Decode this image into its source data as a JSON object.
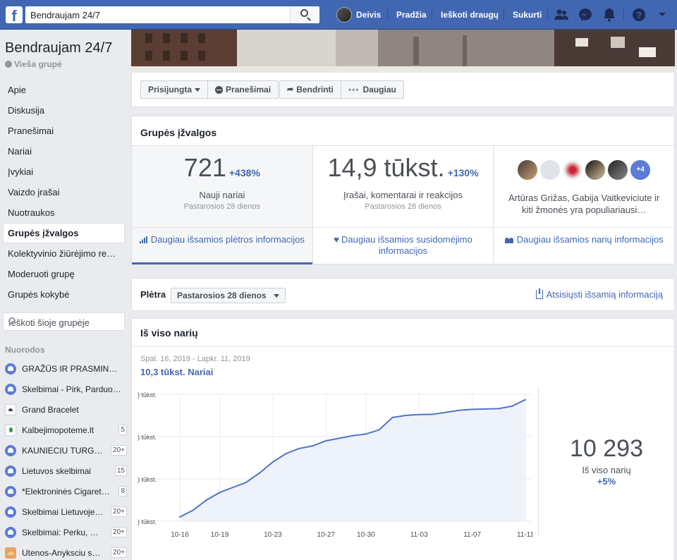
{
  "topbar": {
    "logo": "f",
    "search_value": "Bendraujam 24/7",
    "user_name": "Deivis",
    "nav": [
      "Pradžia",
      "Ieškoti draugų",
      "Sukurti"
    ],
    "icons": [
      "friends-icon",
      "messenger-icon",
      "notifications-icon",
      "help-icon",
      "dropdown-icon"
    ]
  },
  "sidebar": {
    "group_name": "Bendraujam 24/7",
    "group_type": "Vieša grupė",
    "menu": [
      "Apie",
      "Diskusija",
      "Pranešimai",
      "Nariai",
      "Įvykiai",
      "Vaizdo įrašai",
      "Nuotraukos",
      "Grupės įžvalgos",
      "Kolektyvinio žiūrėjimo re…",
      "Moderuoti grupę",
      "Grupės kokybė"
    ],
    "active_item": "Grupės įžvalgos",
    "search_placeholder": "Ieškoti šioje grupėje",
    "shortcuts_title": "Nuorodos",
    "shortcuts": [
      {
        "label": "GRAŽŪS IR PRASMIN…",
        "count": "",
        "icon": "group-icon"
      },
      {
        "label": "Skelbimai - Pirk, Parduo…",
        "count": "",
        "icon": "group-icon"
      },
      {
        "label": "Grand Bracelet",
        "count": "",
        "icon": "page-icon"
      },
      {
        "label": "Kalbejimopoteme.lt",
        "count": "5",
        "icon": "leaf-icon"
      },
      {
        "label": "KAUNIECIU TURG…",
        "count": "20+",
        "icon": "group-icon"
      },
      {
        "label": "Lietuvos skelbimai",
        "count": "15",
        "icon": "group-icon"
      },
      {
        "label": "*Elektroninės Cigaret…",
        "count": "8",
        "icon": "group-icon"
      },
      {
        "label": "Skelbimai Lietuvoje…",
        "count": "20+",
        "icon": "group-icon"
      },
      {
        "label": "Skelbimai: Perku, …",
        "count": "20+",
        "icon": "group-icon"
      },
      {
        "label": "Utenos-Anyksciu s…",
        "count": "20+",
        "icon": "hand-icon"
      }
    ]
  },
  "actions": {
    "joined": "Prisijungta",
    "notifications": "Pranešimai",
    "share": "Bendrinti",
    "more": "Daugiau"
  },
  "insights": {
    "title": "Grupės įžvalgos",
    "members": {
      "value": "721",
      "change": "+438%",
      "label": "Nauji nariai",
      "period": "Pastarosios 28 dienos",
      "link": "Daugiau išsamios plėtros informacijos"
    },
    "engagement": {
      "value": "14,9 tūkst.",
      "change": "+130%",
      "label": "Įrašai, komentarai ir reakcijos",
      "period": "Pastarosios 28 dienos",
      "link": "Daugiau išsamios susidomėjimo informacijos"
    },
    "people": {
      "more": "+4",
      "text": "Artūras Grižas, Gabija Vaitkeviciute ir kiti žmonės yra populiariausi…",
      "link": "Daugiau išsamios narių informacijos"
    }
  },
  "growth": {
    "title": "Plėtra",
    "period_select": "Pastarosios 28 dienos",
    "download": "Atsisiųsti išsamią informaciją"
  },
  "totals": {
    "title": "Iš viso narių",
    "date_range": "Spal. 16, 2019 - Lapkr. 11, 2019",
    "series_label": "10,3 tūkst.  Nariai",
    "total_value": "10 293",
    "total_label": "Iš viso narių",
    "total_change": "+5%"
  },
  "chart_data": {
    "type": "area",
    "x": [
      "10-16",
      "10-17",
      "10-18",
      "10-19",
      "10-20",
      "10-21",
      "10-22",
      "10-23",
      "10-24",
      "10-25",
      "10-26",
      "10-27",
      "10-28",
      "10-29",
      "10-30",
      "10-31",
      "11-01",
      "11-02",
      "11-03",
      "11-04",
      "11-05",
      "11-06",
      "11-07",
      "11-08",
      "11-09",
      "11-10",
      "11-11"
    ],
    "xticks": [
      "10-16",
      "10-19",
      "10-23",
      "10-27",
      "10-30",
      "11-03",
      "11-07",
      "11-11"
    ],
    "ytick_labels": [
      ") tūkst.",
      ") tūkst.",
      ") tūkst.",
      ") tūkst."
    ],
    "ylim": [
      9575,
      10325
    ],
    "values": [
      9600,
      9640,
      9700,
      9745,
      9775,
      9805,
      9860,
      9925,
      9975,
      10005,
      10020,
      10050,
      10065,
      10080,
      10090,
      10115,
      10188,
      10200,
      10205,
      10206,
      10218,
      10230,
      10236,
      10238,
      10240,
      10255,
      10293
    ],
    "series_name": "Nariai",
    "line_color": "#4f74c9",
    "fill_color": "#eef2fa"
  }
}
